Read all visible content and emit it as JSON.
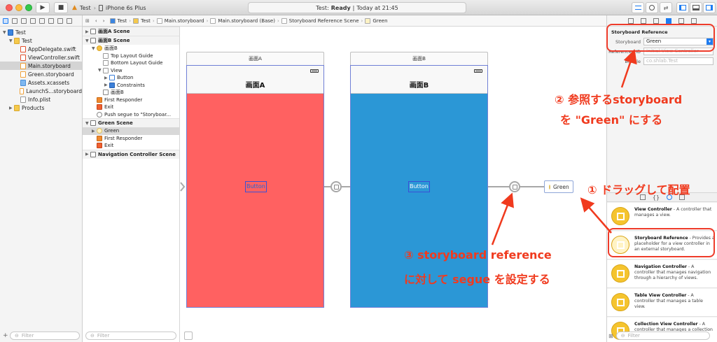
{
  "titlebar": {
    "scheme_target": "Test",
    "scheme_device": "iPhone 6s Plus",
    "status_app": "Test:",
    "status_state": "Ready",
    "status_sep": "|",
    "status_time": "Today at 21:45"
  },
  "navigator": {
    "items": [
      {
        "label": "Test",
        "indent": 0,
        "icon": "proj",
        "disc": "▼"
      },
      {
        "label": "Test",
        "indent": 1,
        "icon": "folder",
        "disc": "▼"
      },
      {
        "label": "AppDelegate.swift",
        "indent": 2,
        "icon": "swift"
      },
      {
        "label": "ViewController.swift",
        "indent": 2,
        "icon": "swift"
      },
      {
        "label": "Main.storyboard",
        "indent": 2,
        "icon": "sb",
        "selected": true
      },
      {
        "label": "Green.storyboard",
        "indent": 2,
        "icon": "sb"
      },
      {
        "label": "Assets.xcassets",
        "indent": 2,
        "icon": "xc"
      },
      {
        "label": "LaunchS...storyboard",
        "indent": 2,
        "icon": "sb"
      },
      {
        "label": "Info.plist",
        "indent": 2,
        "icon": "plist"
      },
      {
        "label": "Products",
        "indent": 1,
        "icon": "folder",
        "disc": "▶"
      }
    ],
    "filter_placeholder": "Filter"
  },
  "jumpbar": {
    "crumbs": [
      "Test",
      "Test",
      "Main.storyboard",
      "Main.storyboard (Base)",
      "Storyboard Reference Scene",
      "Green"
    ]
  },
  "outline": {
    "rows": [
      {
        "label": "画面A Scene",
        "type": "scene",
        "indent": 0,
        "disc": "▶"
      },
      {
        "label": "画面B Scene",
        "type": "scene",
        "indent": 0,
        "disc": "▼"
      },
      {
        "label": "画面B",
        "type": "vc",
        "indent": 1,
        "disc": "▼"
      },
      {
        "label": "Top Layout Guide",
        "type": "view",
        "indent": 2
      },
      {
        "label": "Bottom Layout Guide",
        "type": "view",
        "indent": 2
      },
      {
        "label": "View",
        "type": "view",
        "indent": 2,
        "disc": "▼"
      },
      {
        "label": "Button",
        "type": "btn",
        "indent": 3,
        "disc": "▶"
      },
      {
        "label": "Constraints",
        "type": "con",
        "indent": 3,
        "disc": "▶"
      },
      {
        "label": "画面B",
        "type": "back",
        "indent": 2
      },
      {
        "label": "First Responder",
        "type": "fr",
        "indent": 1
      },
      {
        "label": "Exit",
        "type": "exit",
        "indent": 1
      },
      {
        "label": "Push segue to \"Storyboar...",
        "type": "seg",
        "indent": 1
      },
      {
        "label": "Green Scene",
        "type": "scene",
        "indent": 0,
        "disc": "▼"
      },
      {
        "label": "Green",
        "type": "ref",
        "indent": 1,
        "disc": "▶",
        "selected": true
      },
      {
        "label": "First Responder",
        "type": "fr",
        "indent": 1
      },
      {
        "label": "Exit",
        "type": "exit",
        "indent": 1
      },
      {
        "label": "Navigation Controller Scene",
        "type": "scene",
        "indent": 0,
        "disc": "▶"
      }
    ],
    "filter_placeholder": "Filter"
  },
  "canvas": {
    "screen_a": {
      "header": "画面A",
      "nav_title": "画面A",
      "button": "Button",
      "color": "#ff6161"
    },
    "screen_b": {
      "header": "画面B",
      "nav_title": "画面B",
      "button": "Button",
      "color": "#2b97d6"
    },
    "reference": {
      "label": "Green"
    }
  },
  "inspector": {
    "section_title": "Storyboard Reference",
    "storyboard_label": "Storyboard",
    "storyboard_value": "Green",
    "referenced_id_label": "Referenced ID",
    "referenced_id_placeholder": "Initial View Controller",
    "bundle_label": "Bundle",
    "bundle_placeholder": "co.shlab.Test"
  },
  "library": {
    "items": [
      {
        "title": "View Controller",
        "desc": " - A controller that manages a view.",
        "icon_color": "#f5c42e"
      },
      {
        "title": "Storyboard Reference",
        "desc": " - Provides a placeholder for a view controller in an external storyboard.",
        "icon_color": "#fff3c4"
      },
      {
        "title": "Navigation Controller",
        "desc": " - A controller that manages navigation through a hierarchy of views.",
        "icon_color": "#f5c42e"
      },
      {
        "title": "Table View Controller",
        "desc": " - A controller that manages a table view.",
        "icon_color": "#f5c42e"
      },
      {
        "title": "Collection View Controller",
        "desc": " - A controller that manages a collection",
        "icon_color": "#f5c42e"
      }
    ],
    "filter_placeholder": "Filter"
  },
  "annotations": {
    "step2_line1": "② 参照するstoryboard",
    "step2_line2": "を \"Green\" にする",
    "step1": "① ドラッグして配置",
    "step3_line1": "③ storyboard reference",
    "step3_line2": "に対して segue を設定する",
    "color": "#f03a1e"
  }
}
